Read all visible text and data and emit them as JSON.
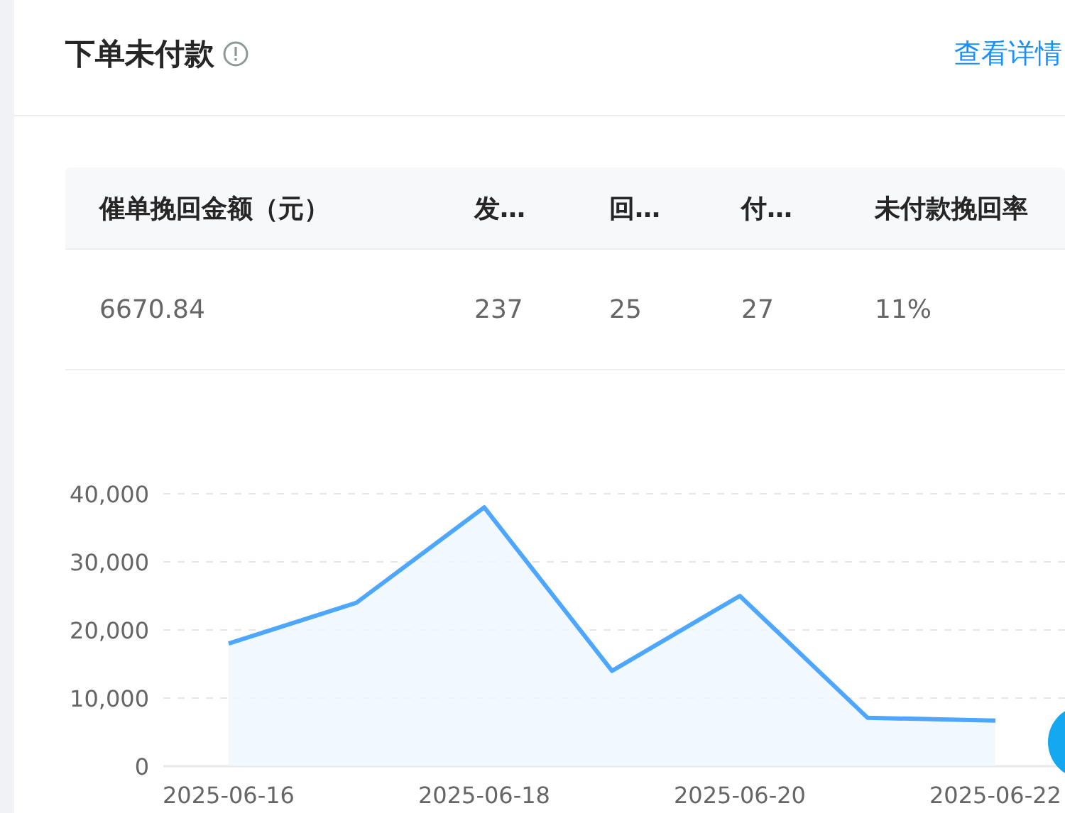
{
  "header": {
    "title": "下单未付款",
    "link": "查看详情"
  },
  "table": {
    "columns": [
      "催单挽回金额（元）",
      "发…",
      "回…",
      "付…",
      "未付款挽回率"
    ],
    "rows": [
      [
        "6670.84",
        "237",
        "25",
        "27",
        "11%"
      ]
    ]
  },
  "chart": {
    "chart_data": {
      "type": "area",
      "categories": [
        "2025-06-16",
        null,
        "2025-06-18",
        null,
        "2025-06-20",
        null,
        "2025-06-22"
      ],
      "series": [
        {
          "color": "#4da6ff",
          "values": [
            18000,
            24000,
            38000,
            14000,
            25000,
            7100,
            6700
          ]
        }
      ],
      "grid": true,
      "ylim": [
        0,
        40000
      ],
      "yticks": [
        {
          "value": 0,
          "label": "0"
        },
        {
          "value": 10000,
          "label": "10,000"
        },
        {
          "value": 20000,
          "label": "20,000"
        },
        {
          "value": 30000,
          "label": "30,000"
        },
        {
          "value": 40000,
          "label": "40,000"
        }
      ]
    }
  }
}
